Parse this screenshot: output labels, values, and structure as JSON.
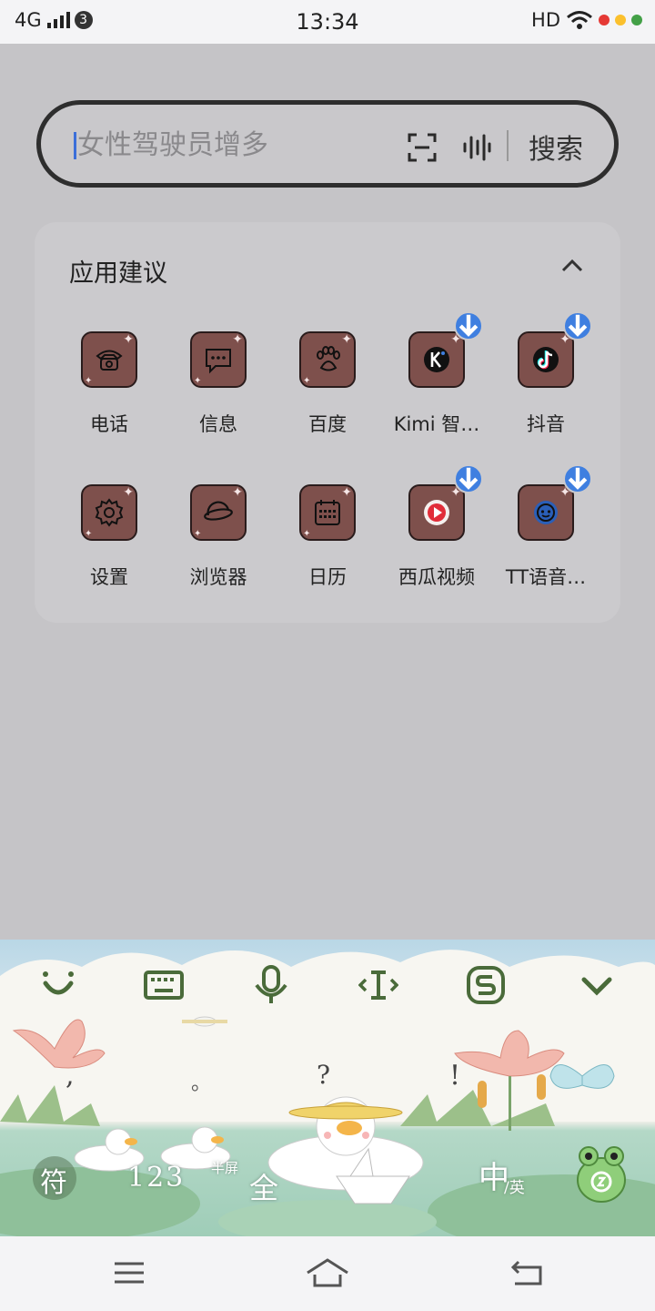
{
  "status_bar": {
    "network": "4G",
    "sim_badge": "3",
    "time": "13:34",
    "hd": "HD",
    "dot_colors": [
      "#e53935",
      "#fbc02d",
      "#43a047"
    ]
  },
  "search": {
    "placeholder": "女性驾驶员增多",
    "scan_icon": "scan-icon",
    "voice_icon": "voice-icon",
    "button_label": "搜索"
  },
  "suggestions": {
    "title": "应用建议",
    "apps": [
      {
        "label": "电话",
        "icon": "phone-icon",
        "download": false
      },
      {
        "label": "信息",
        "icon": "message-icon",
        "download": false
      },
      {
        "label": "百度",
        "icon": "paw-icon",
        "download": false
      },
      {
        "label": "Kimi 智…",
        "icon": "kimi-icon",
        "download": true
      },
      {
        "label": "抖音",
        "icon": "douyin-icon",
        "download": true
      },
      {
        "label": "设置",
        "icon": "gear-icon",
        "download": false
      },
      {
        "label": "浏览器",
        "icon": "planet-icon",
        "download": false
      },
      {
        "label": "日历",
        "icon": "calendar-icon",
        "download": false
      },
      {
        "label": "西瓜视频",
        "icon": "play-icon",
        "download": true
      },
      {
        "label": "TT语音…",
        "icon": "tt-voice-icon",
        "download": true
      }
    ],
    "colors": {
      "icon_bg": "#7e504c",
      "badge": "#3f7fe0"
    }
  },
  "keyboard": {
    "toolbar": [
      "smile-icon",
      "keyboard-icon",
      "mic-icon",
      "cursor-icon",
      "sogou-icon",
      "chevron-down-icon"
    ],
    "symbol_key": "符",
    "number_key": "123",
    "half_full_small": "半屏",
    "half_full_big": "全",
    "lang_big": "中",
    "lang_small": "/英",
    "punct_comma": ",",
    "punct_period": "。",
    "punct_question": "?",
    "punct_exclaim": "!",
    "accent_color": "#4a6b3a"
  },
  "nav_bar": {
    "icons": [
      "menu-icon",
      "home-icon",
      "back-icon"
    ]
  }
}
